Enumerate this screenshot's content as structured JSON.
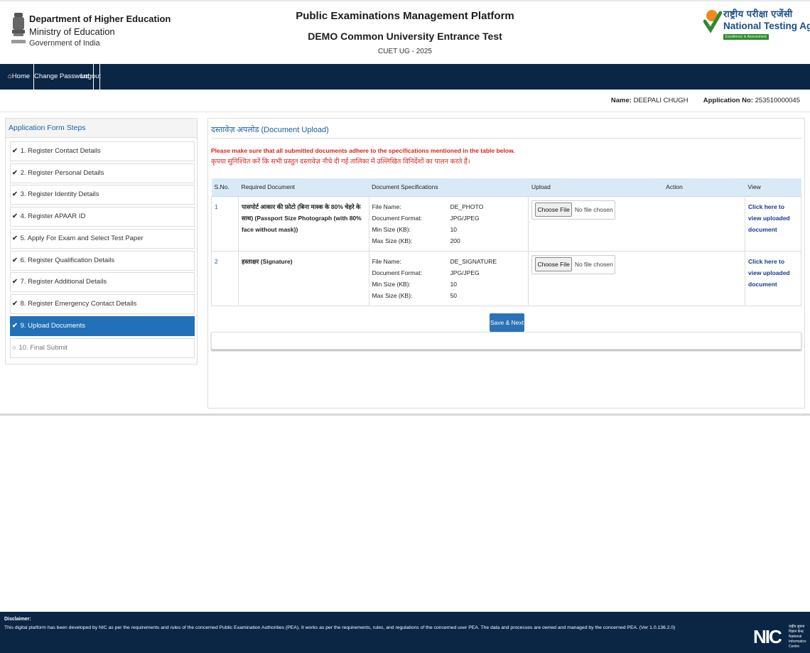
{
  "header": {
    "dept_line1": "Department of Higher Education",
    "dept_line2": "Ministry of Education",
    "dept_line3": "Government of India",
    "title1": "Public Examinations Management Platform",
    "title2": "DEMO Common University Entrance Test",
    "title3": "CUET UG - 2025",
    "nta_hindi": "राष्ट्रीय परीक्षा एजेंसी",
    "nta_english": "National Testing Agency",
    "nta_tagline": "Excellence in Assessment"
  },
  "nav": {
    "home": "Home",
    "change_password": "Change Password",
    "logout": "Logout"
  },
  "info": {
    "name_label": "Name:",
    "name_value": "DEEPALI CHUGH",
    "app_label": "Application No:",
    "app_value": "253510000045"
  },
  "sidebar": {
    "title": "Application Form Steps",
    "steps": [
      {
        "label": "1. Register Contact Details"
      },
      {
        "label": "2. Register Personal Details"
      },
      {
        "label": "3. Register Identity Details"
      },
      {
        "label": "4. Register APAAR ID"
      },
      {
        "label": "5. Apply For Exam and Select Test Paper"
      },
      {
        "label": "6. Register Qualification Details"
      },
      {
        "label": "7. Register Additional Details"
      },
      {
        "label": "8. Register Emergency Contact Details"
      },
      {
        "label": "9. Upload Documents"
      },
      {
        "label": "10. Final Submit"
      }
    ]
  },
  "main": {
    "title": "दस्तावेज़ अपलोड (Document Upload)",
    "warning_en": "Please make sure that all submitted documents adhere to the specifications mentioned in the table below.",
    "warning_hi": "कृपया सुनिश्चित करें कि सभी प्रस्तुत दस्तावेज़ नीचे दी गई तालिका में उल्लिखित विनिर्देशों का पालन करते हैं।",
    "columns": [
      "S.No.",
      "Required Document",
      "Document Specifications",
      "Upload",
      "Action",
      "View"
    ],
    "spec_keys": {
      "file_name": "File Name:",
      "format": "Document Format:",
      "min": "Min Size (KB):",
      "max": "Max Size (KB):"
    },
    "rows": [
      {
        "sno": "1",
        "doc": "पासपोर्ट आकार की फ़ोटो (बिना मास्क के 80% चेहरे के साथ) (Passport Size Photograph (with 80% face without mask))",
        "file_name": "DE_PHOTO",
        "format": "JPG/JPEG",
        "min": "10",
        "max": "200",
        "choose": "Choose File",
        "no_file": "No file chosen",
        "view": "Click here to view uploaded document"
      },
      {
        "sno": "2",
        "doc": "हस्ताक्षर (Signature)",
        "file_name": "DE_SIGNATURE",
        "format": "JPG/JPEG",
        "min": "10",
        "max": "50",
        "choose": "Choose File",
        "no_file": "No file chosen",
        "view": "Click here to view uploaded document"
      }
    ],
    "save_next": "Save & Next"
  },
  "footer": {
    "disclaimer_label": "Disclaimer:",
    "disclaimer_text": "This digital platform has been developed by NIC as per the requirements and rules of the concerned Public Examination Authorities (PEA). It works as per the requirements, rules, and regulations of the concerned user PEA. The data and processes are owned and managed by the concerned PEA. (Ver 1.0.136.2.0)",
    "nic_big": "NIC",
    "nic_small": "राष्ट्रीय सूचना विज्ञान केन्द्र National Informatics Centre"
  },
  "colors": {
    "navy": "#0b2545",
    "accent_blue": "#2271b8",
    "warning_red": "#d8231c",
    "table_head": "#d9eaf6"
  }
}
